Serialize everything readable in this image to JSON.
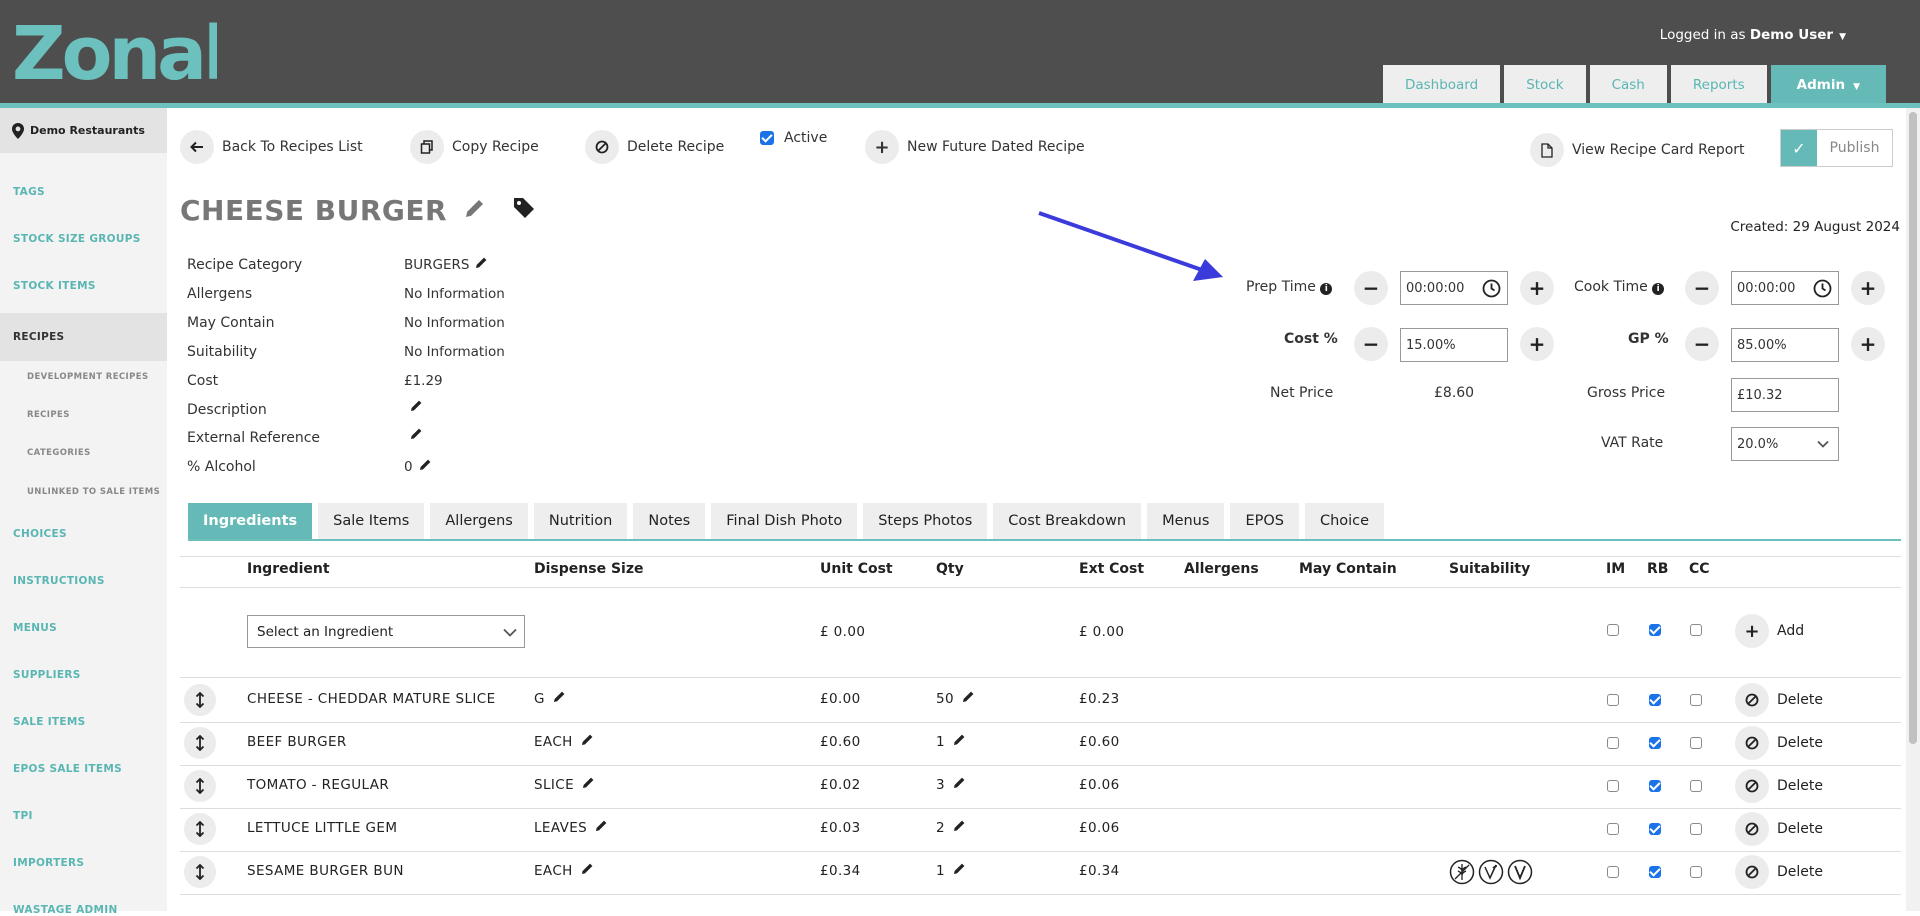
{
  "header": {
    "logo_text": "Zonal",
    "logged_in_prefix": "Logged in as",
    "user_name": "Demo User",
    "nav": [
      "Dashboard",
      "Stock",
      "Cash",
      "Reports",
      "Admin"
    ]
  },
  "sidebar": {
    "org": "Demo Restaurants",
    "items": [
      "TAGS",
      "STOCK SIZE GROUPS",
      "STOCK ITEMS",
      "RECIPES",
      "CHOICES",
      "INSTRUCTIONS",
      "MENUS",
      "SUPPLIERS",
      "SALE ITEMS",
      "EPOS SALE ITEMS",
      "TPI",
      "IMPORTERS",
      "WASTAGE ADMIN"
    ],
    "sub_items": [
      "DEVELOPMENT RECIPES",
      "RECIPES",
      "CATEGORIES",
      "UNLINKED TO SALE ITEMS"
    ]
  },
  "toolbar": {
    "back": "Back To Recipes List",
    "copy": "Copy Recipe",
    "delete": "Delete Recipe",
    "active": "Active",
    "active_checked": true,
    "new_future": "New Future Dated Recipe",
    "view_report": "View Recipe Card Report",
    "publish": "Publish"
  },
  "recipe": {
    "title": "CHEESE BURGER",
    "created": "Created: 29 August 2024",
    "details": [
      {
        "label": "Recipe Category",
        "value": "BURGERS",
        "editable": true
      },
      {
        "label": "Allergens",
        "value": "No Information",
        "editable": false
      },
      {
        "label": "May Contain",
        "value": "No Information",
        "editable": false
      },
      {
        "label": "Suitability",
        "value": "No Information",
        "editable": false
      },
      {
        "label": "Cost",
        "value": "£1.29",
        "editable": false
      },
      {
        "label": "Description",
        "value": "",
        "editable": true
      },
      {
        "label": "External Reference",
        "value": "",
        "editable": true
      },
      {
        "label": "% Alcohol",
        "value": "0",
        "editable": true
      }
    ]
  },
  "pricing": {
    "prep_time_label": "Prep Time",
    "prep_time": "00:00:00",
    "cook_time_label": "Cook Time",
    "cook_time": "00:00:00",
    "cost_pct_label": "Cost %",
    "cost_pct": "15.00%",
    "gp_pct_label": "GP %",
    "gp_pct": "85.00%",
    "net_price_label": "Net Price",
    "net_price": "£8.60",
    "gross_price_label": "Gross Price",
    "gross_price": "£10.32",
    "vat_label": "VAT Rate",
    "vat": "20.0%"
  },
  "tabs": [
    "Ingredients",
    "Sale Items",
    "Allergens",
    "Nutrition",
    "Notes",
    "Final Dish Photo",
    "Steps Photos",
    "Cost Breakdown",
    "Menus",
    "EPOS",
    "Choice"
  ],
  "table": {
    "headers": [
      "Ingredient",
      "Dispense Size",
      "Unit Cost",
      "Qty",
      "Ext Cost",
      "Allergens",
      "May Contain",
      "Suitability",
      "IM",
      "RB",
      "CC"
    ],
    "new_row": {
      "select_placeholder": "Select an Ingredient",
      "unit_cost": "£ 0.00",
      "ext_cost": "£ 0.00",
      "add_label": "Add",
      "im": false,
      "rb": true,
      "cc": false
    },
    "rows": [
      {
        "ingredient": "CHEESE - CHEDDAR MATURE SLICE",
        "dispense": "G",
        "unit_cost": "£0.00",
        "qty": "50",
        "ext_cost": "£0.23",
        "im": false,
        "rb": true,
        "cc": false,
        "suitability_icons": []
      },
      {
        "ingredient": "BEEF BURGER",
        "dispense": "EACH",
        "unit_cost": "£0.60",
        "qty": "1",
        "ext_cost": "£0.60",
        "im": false,
        "rb": true,
        "cc": false,
        "suitability_icons": []
      },
      {
        "ingredient": "TOMATO - REGULAR",
        "dispense": "SLICE",
        "unit_cost": "£0.02",
        "qty": "3",
        "ext_cost": "£0.06",
        "im": false,
        "rb": true,
        "cc": false,
        "suitability_icons": []
      },
      {
        "ingredient": "LETTUCE LITTLE GEM",
        "dispense": "LEAVES",
        "unit_cost": "£0.03",
        "qty": "2",
        "ext_cost": "£0.06",
        "im": false,
        "rb": true,
        "cc": false,
        "suitability_icons": []
      },
      {
        "ingredient": "SESAME BURGER BUN",
        "dispense": "EACH",
        "unit_cost": "£0.34",
        "qty": "1",
        "ext_cost": "£0.34",
        "im": false,
        "rb": true,
        "cc": false,
        "suitability_icons": [
          "gluten-free-icon",
          "vegan-icon",
          "vegetarian-icon"
        ]
      }
    ],
    "delete_label": "Delete"
  },
  "colors": {
    "accent": "#65bab7",
    "header": "#4e4e4e",
    "annotation_arrow": "#3b3bdc"
  }
}
